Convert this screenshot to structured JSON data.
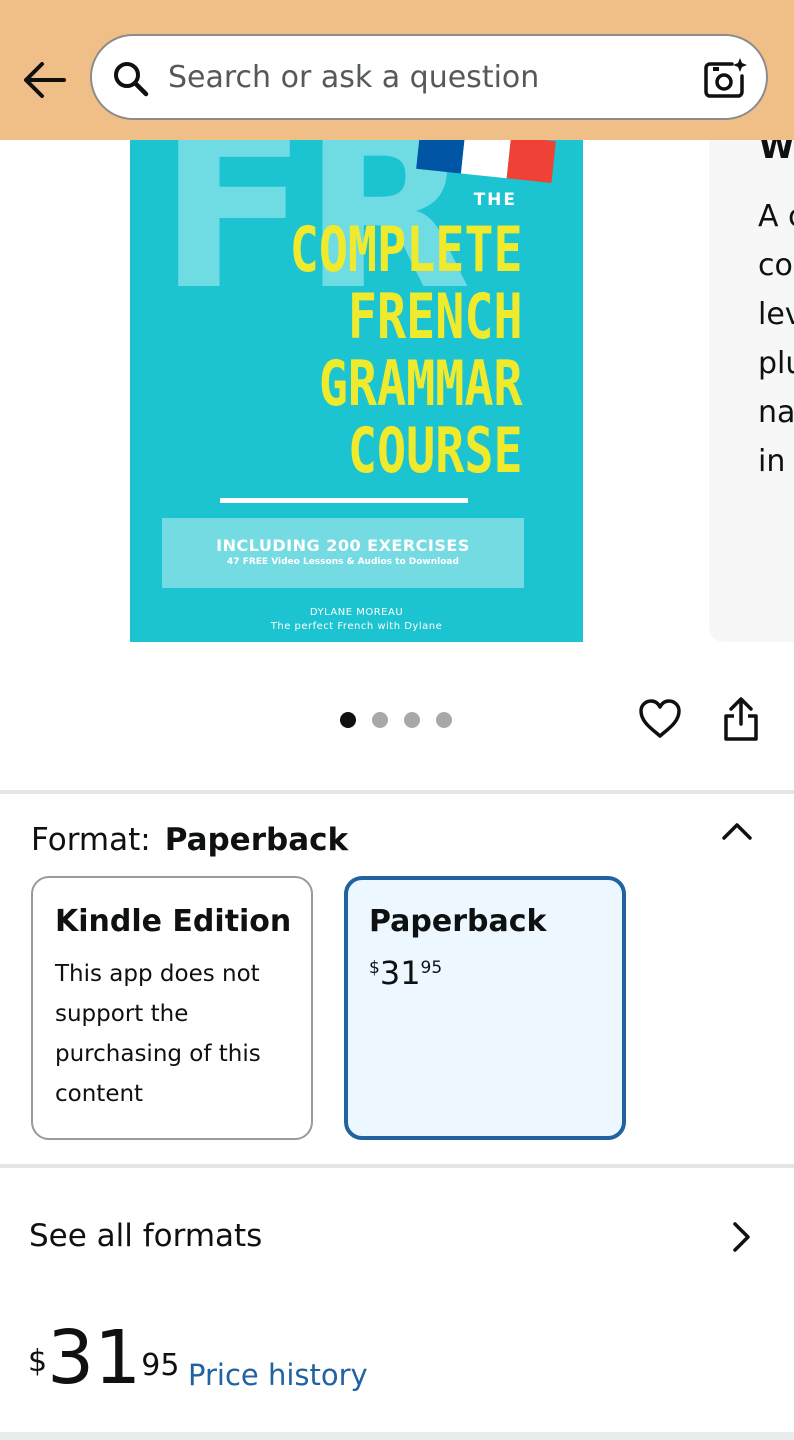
{
  "header": {
    "search_placeholder": "Search or ask a question"
  },
  "cover": {
    "big_letters": "FR",
    "the": "THE",
    "title_lines": [
      "COMPLETE",
      "FRENCH",
      "GRAMMAR",
      "COURSE"
    ],
    "box_line1": "INCLUDING 200 EXERCISES",
    "box_line2": "47 FREE Video Lessons & Audios to Download",
    "author": "DYLANE MOREAU",
    "tagline": "The perfect French with Dylane",
    "flag_colors": [
      "#0055a4",
      "#ffffff",
      "#ef4135"
    ]
  },
  "description": {
    "heading": "W",
    "text": "A c\nco\nlev\nplu\nna\nin"
  },
  "carousel": {
    "total": 4,
    "active_index": 0
  },
  "format": {
    "label": "Format:",
    "selected": "Paperback",
    "options": [
      {
        "title": "Kindle Edition",
        "description": "This app does not support the purchasing of this content"
      },
      {
        "title": "Paperback",
        "currency": "$",
        "price_whole": "31",
        "price_fraction": "95"
      }
    ]
  },
  "see_all_formats": "See all formats",
  "price": {
    "currency": "$",
    "whole": "31",
    "fraction": "95"
  },
  "price_history": "Price history",
  "colors": {
    "header_bg": "#efbf87",
    "link": "#2162a1",
    "selected_border": "#2162a1",
    "selected_bg": "#edf7ff",
    "cover_bg": "#1cc3d1",
    "cover_title": "#f0ea2d"
  }
}
